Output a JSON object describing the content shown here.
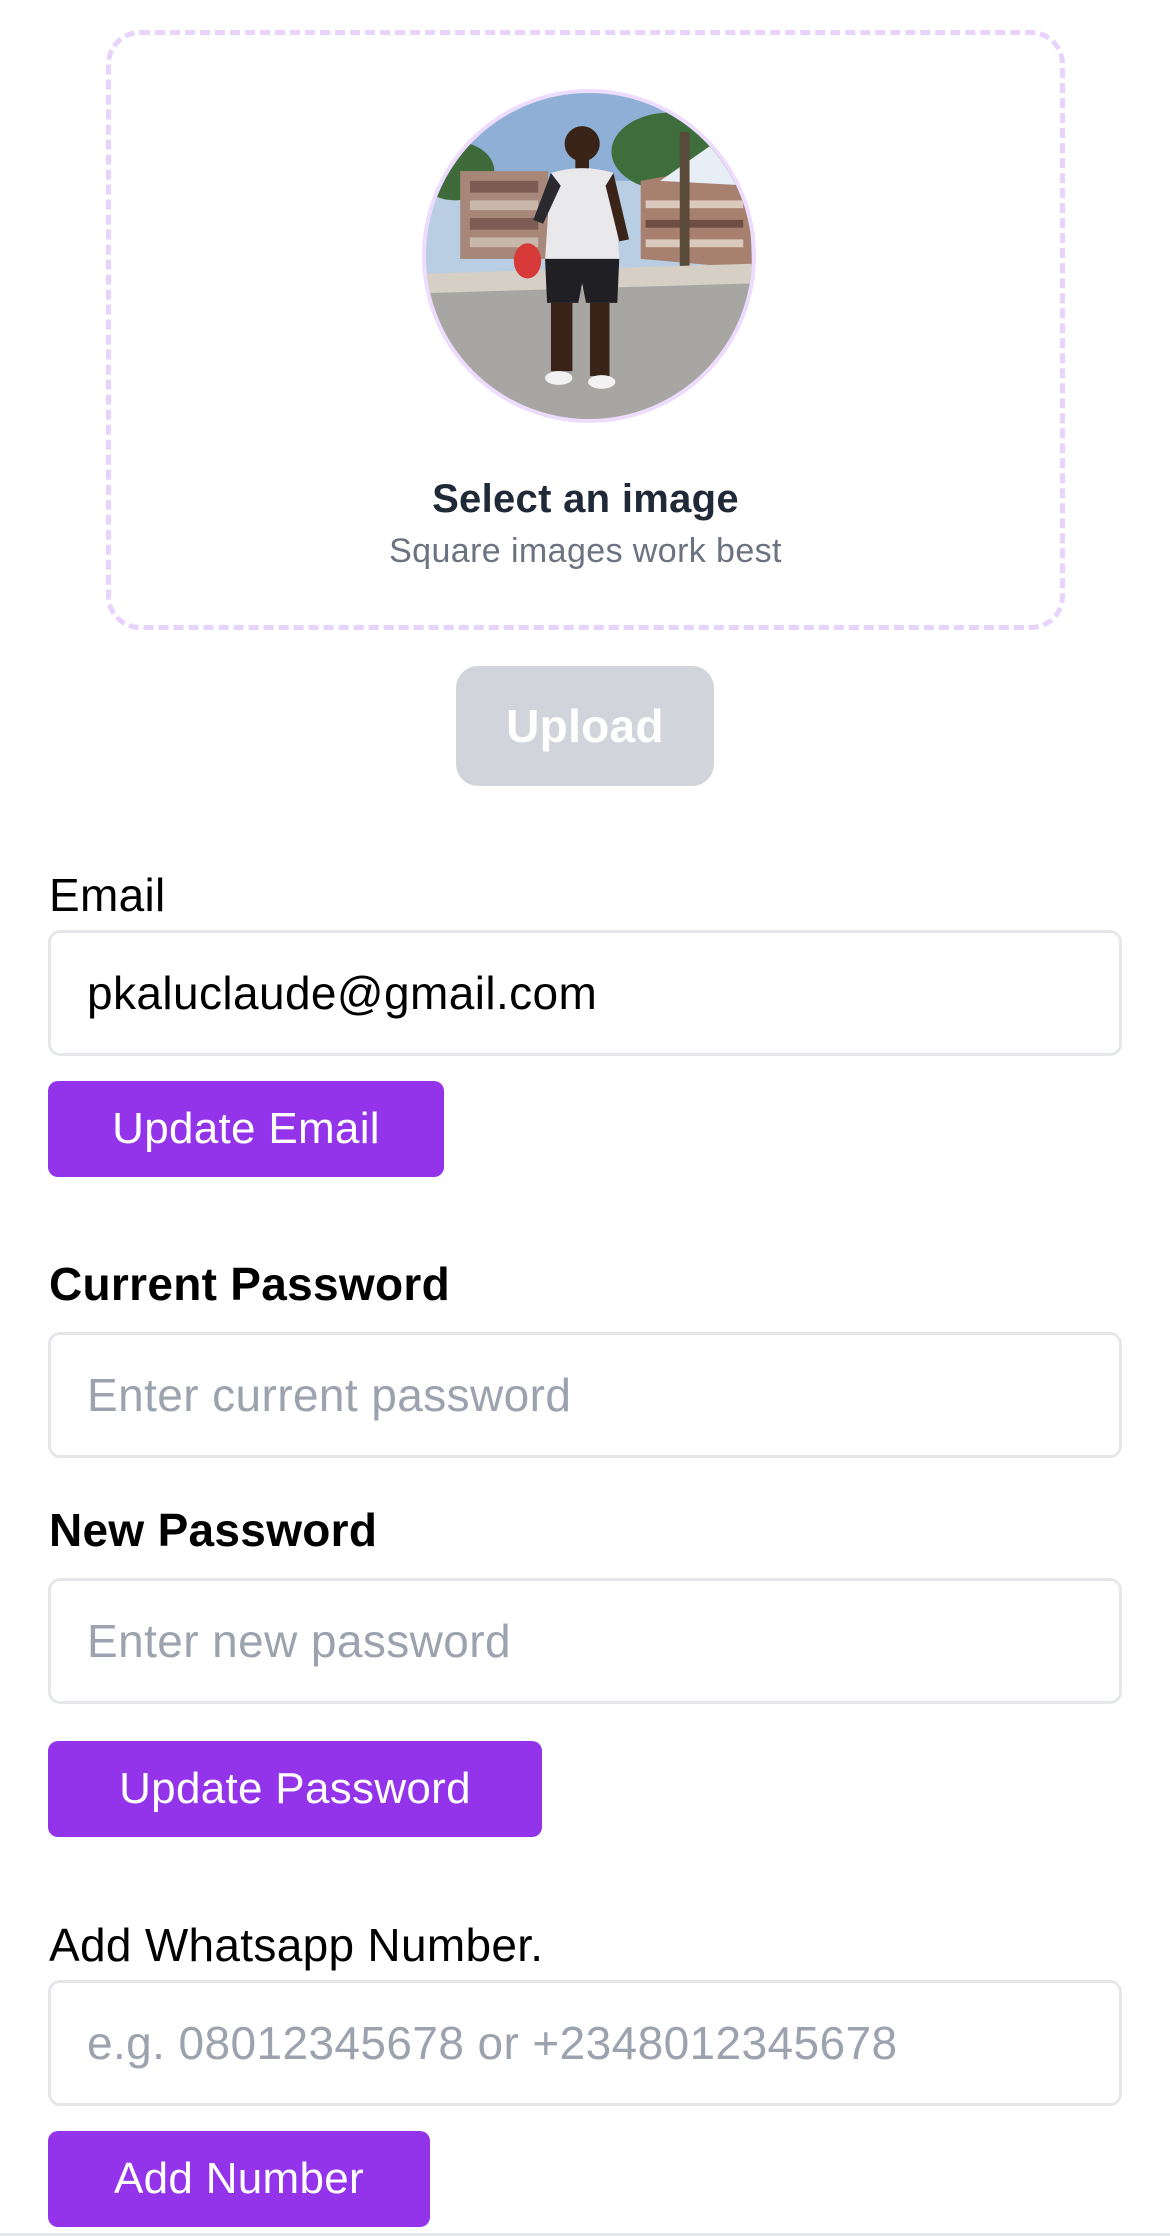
{
  "image_picker": {
    "title": "Select an image",
    "subtitle": "Square images work best",
    "avatar_icon": "profile-photo"
  },
  "upload_button": {
    "label": "Upload",
    "disabled": true
  },
  "email_section": {
    "label": "Email",
    "value": "pkaluclaude@gmail.com",
    "button_label": "Update Email"
  },
  "password_section": {
    "current_label": "Current Password",
    "current_placeholder": "Enter current password",
    "new_label": "New Password",
    "new_placeholder": "Enter new password",
    "button_label": "Update Password"
  },
  "whatsapp_section": {
    "label": "Add Whatsapp Number.",
    "placeholder": "e.g. 08012345678 or +2348012345678",
    "button_label": "Add Number"
  },
  "colors": {
    "accent": "#9333ea",
    "dropzone_border": "#e7d3fb",
    "disabled_button": "#d1d5db",
    "input_border": "#e5e7eb",
    "placeholder": "#9ca3af"
  }
}
